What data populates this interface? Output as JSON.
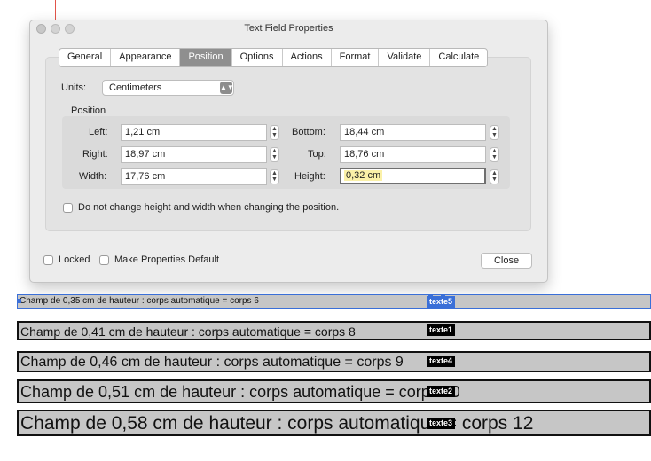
{
  "dialog": {
    "title": "Text Field Properties",
    "tabs": [
      "General",
      "Appearance",
      "Position",
      "Options",
      "Actions",
      "Format",
      "Validate",
      "Calculate"
    ],
    "active_tab": "Position",
    "units_label": "Units:",
    "units_value": "Centimeters",
    "position_group_label": "Position",
    "fields": {
      "left_label": "Left:",
      "left_value": "1,21 cm",
      "right_label": "Right:",
      "right_value": "18,97 cm",
      "width_label": "Width:",
      "width_value": "17,76 cm",
      "bottom_label": "Bottom:",
      "bottom_value": "18,44 cm",
      "top_label": "Top:",
      "top_value": "18,76 cm",
      "height_label": "Height:",
      "height_value": "0,32 cm"
    },
    "keep_size_label": "Do not change height and width when changing the position.",
    "locked_label": "Locked",
    "make_default_label": "Make Properties Default",
    "close_label": "Close"
  },
  "document": {
    "rows": [
      {
        "text": "Champ de 0,35 cm de hauteur : corps automatique = corps 6",
        "tag": "texte5"
      },
      {
        "text": "Champ de 0,41 cm de hauteur : corps automatique = corps 8",
        "tag": "texte1"
      },
      {
        "text": "Champ de 0,46 cm de hauteur : corps automatique = corps 9",
        "tag": "texte4"
      },
      {
        "text": "Champ de 0,51 cm de hauteur : corps automatique = corps 10",
        "tag": "texte2"
      },
      {
        "text": "Champ de 0,58 cm de hauteur : corps automatique = corps 12",
        "tag": "texte3"
      }
    ]
  },
  "colors": {
    "selection": "#3a6fd8",
    "field_bg": "#c6c6c6",
    "active_tab": "#8f8f8f"
  }
}
